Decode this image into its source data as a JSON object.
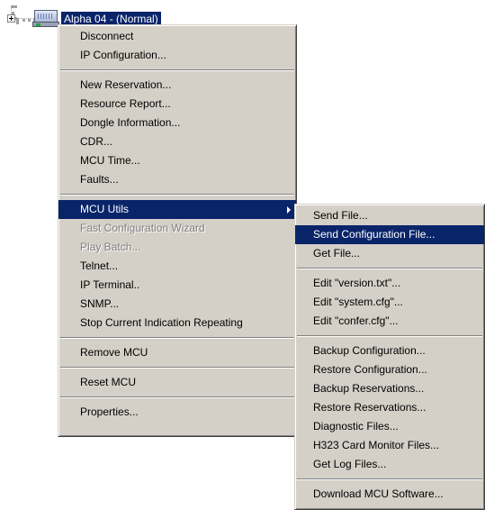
{
  "tree": {
    "node_label": "Alpha 04 - (Normal)"
  },
  "context_menu": {
    "groups": [
      [
        "Disconnect",
        "IP Configuration..."
      ],
      [
        "New Reservation...",
        "Resource Report...",
        "Dongle Information...",
        "CDR...",
        "MCU Time...",
        "Faults..."
      ],
      [
        "MCU Utils",
        "Fast Configuration Wizard",
        "Play Batch...",
        "Telnet...",
        "IP Terminal..",
        "SNMP...",
        "Stop Current Indication Repeating"
      ],
      [
        "Remove MCU"
      ],
      [
        "Reset MCU"
      ],
      [
        "Properties..."
      ]
    ],
    "disabled_items": [
      "Fast Configuration Wizard",
      "Play Batch..."
    ],
    "active_item": "MCU Utils"
  },
  "submenu": {
    "groups": [
      [
        "Send File...",
        "Send Configuration File...",
        "Get File..."
      ],
      [
        "Edit \"version.txt\"...",
        "Edit \"system.cfg\"...",
        "Edit \"confer.cfg\"..."
      ],
      [
        "Backup Configuration...",
        "Restore Configuration...",
        "Backup Reservations...",
        "Restore Reservations...",
        "Diagnostic Files...",
        "H323 Card Monitor Files...",
        "Get Log Files..."
      ],
      [
        "Download MCU Software..."
      ]
    ],
    "highlighted_item": "Send Configuration File..."
  },
  "colors": {
    "menu_bg": "#d4d0c8",
    "highlight": "#0a246a",
    "disabled_text": "#808080"
  }
}
